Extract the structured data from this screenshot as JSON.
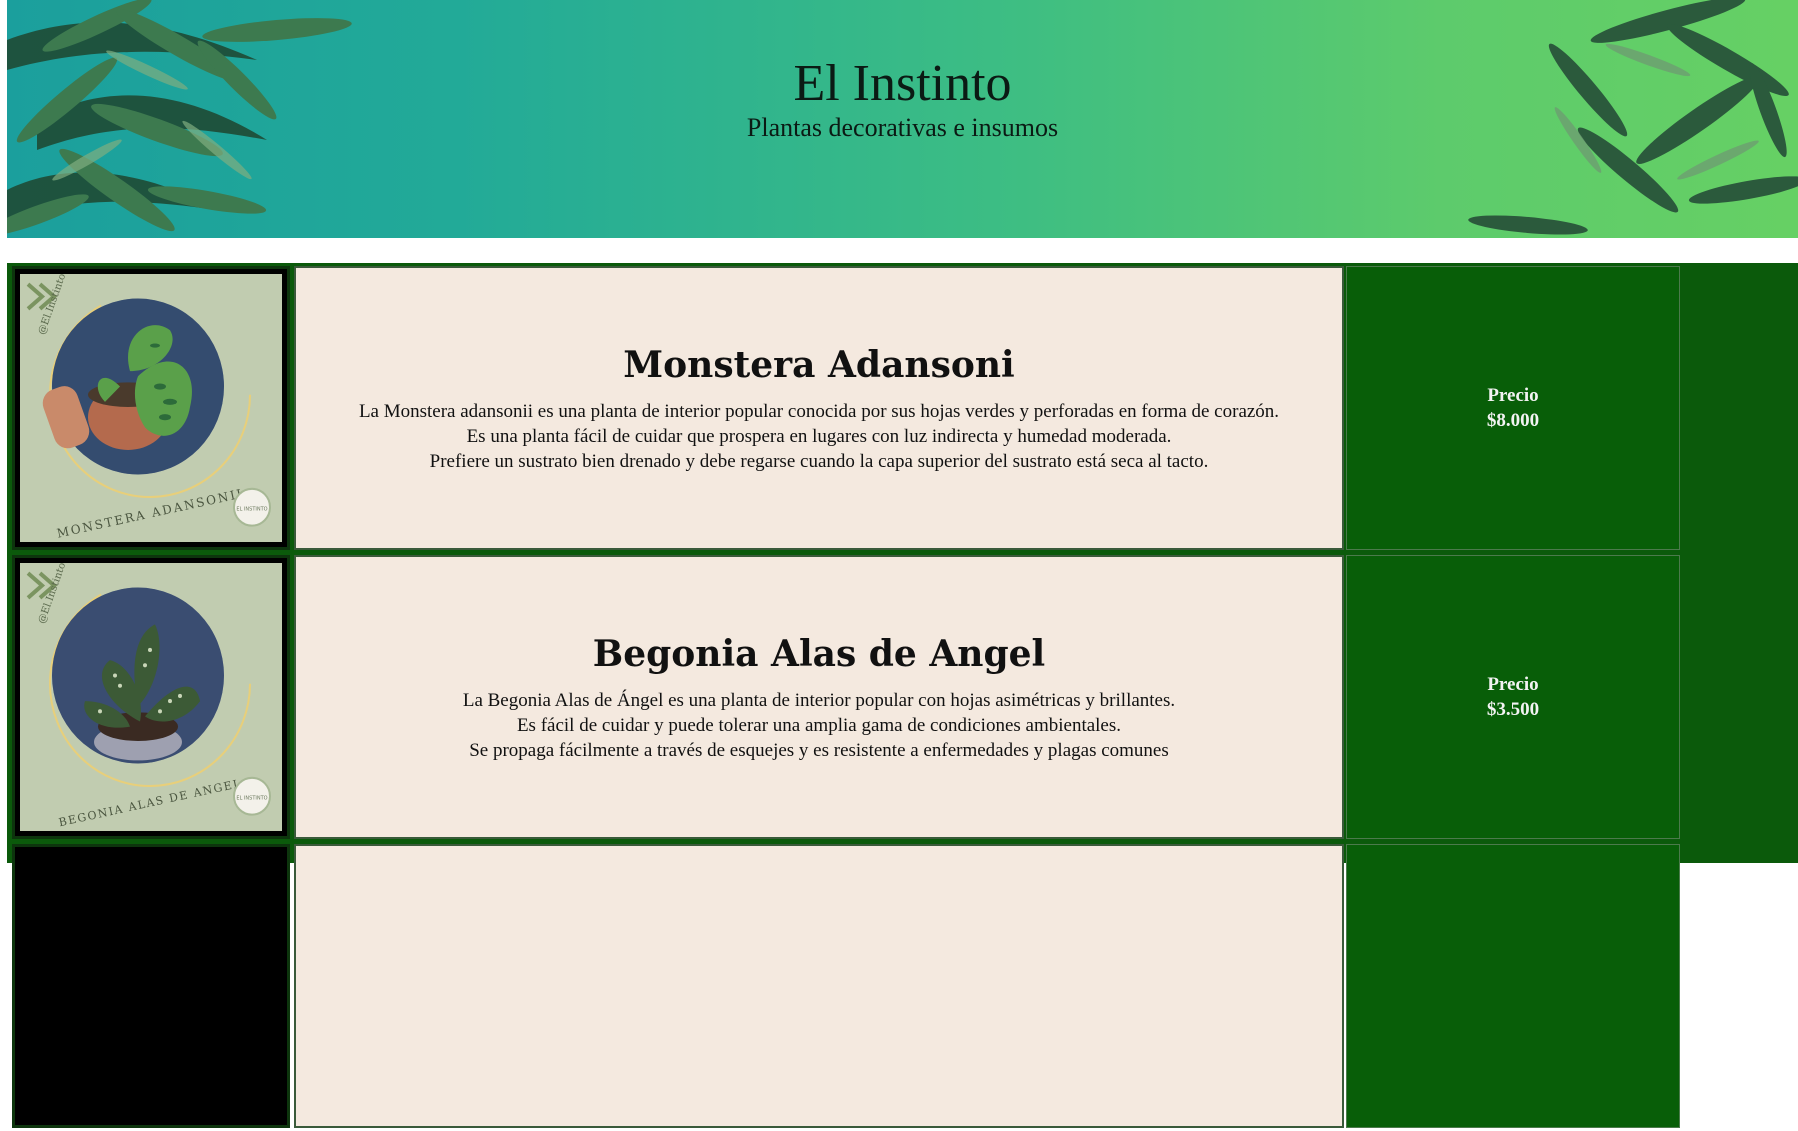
{
  "header": {
    "title": "El Instinto",
    "subtitle": "Plantas decorativas e insumos"
  },
  "colors": {
    "banner_start": "#1b9f9d",
    "banner_end": "#66d064",
    "table_bg": "#0b5a0b",
    "desc_bg": "#f4e9df",
    "price_bg": "#085e08",
    "card_bg": "#c1ccb0"
  },
  "products": [
    {
      "name": "Monstera Adansoni",
      "description": "La Monstera adansonii es una planta de interior popular conocida por sus hojas verdes y perforadas en forma de corazón.\nEs una planta fácil de cuidar que prospera en lugares con luz indirecta y humedad moderada.\nPrefiere un sustrato bien drenado y debe regarse cuando la capa superior del sustrato está seca al tacto.",
      "price_label": "Precio",
      "price": "$8.000",
      "image": {
        "brand": "@El.Instinto",
        "caption": "MONSTERA ADANSONII",
        "logo": "EL INSTINTO",
        "icon": "monstera-plant-photo"
      }
    },
    {
      "name": "Begonia Alas de Angel",
      "description": "La Begonia Alas de Ángel es una planta de interior popular con hojas asimétricas y brillantes.\nEs fácil de cuidar y puede tolerar una amplia gama de condiciones ambientales.\nSe propaga fácilmente a través de esquejes y es resistente a enfermedades y plagas comunes",
      "price_label": "Precio",
      "price": "$3.500",
      "image": {
        "brand": "@El.Instinto",
        "caption": "BEGONIA ALAS DE ANGEL",
        "logo": "EL INSTINTO",
        "icon": "begonia-plant-photo"
      }
    }
  ]
}
